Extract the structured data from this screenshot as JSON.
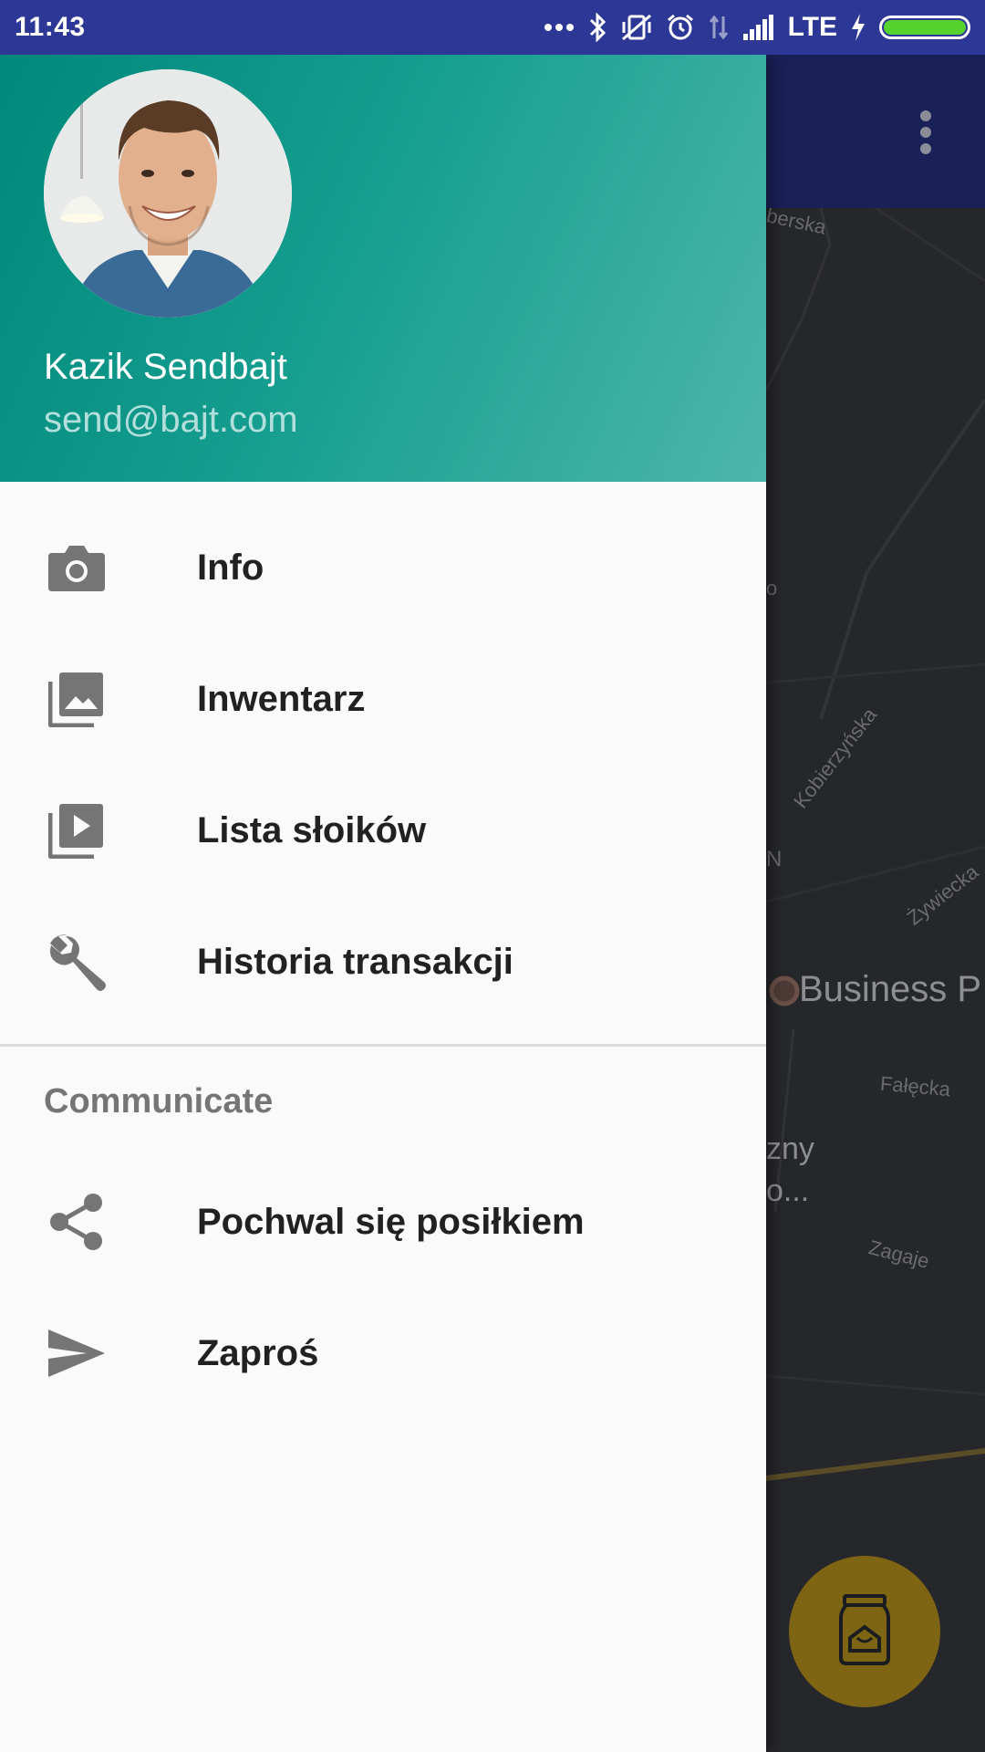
{
  "status_bar": {
    "time": "11:43",
    "network": "LTE",
    "icons": [
      "more-dots-icon",
      "bluetooth-icon",
      "vibrate-off-icon",
      "alarm-icon",
      "data-arrows-icon",
      "signal-icon",
      "charging-icon",
      "battery-icon"
    ],
    "battery_color": "#57d22e"
  },
  "drawer": {
    "header": {
      "user_name": "Kazik Sendbajt",
      "user_email": "send@bajt.com",
      "gradient": [
        "#00897b",
        "#4db6ac"
      ]
    },
    "items": [
      {
        "label": "Info",
        "icon": "camera-icon"
      },
      {
        "label": "Inwentarz",
        "icon": "photo-library-icon"
      },
      {
        "label": "Lista słoików",
        "icon": "video-library-icon"
      },
      {
        "label": "Historia transakcji",
        "icon": "wrench-icon"
      }
    ],
    "section_title": "Communicate",
    "section_items": [
      {
        "label": "Pochwal się posiłkiem",
        "icon": "share-icon"
      },
      {
        "label": "Zaproś",
        "icon": "send-icon"
      }
    ]
  },
  "background": {
    "map_labels": [
      "berska",
      "Kobierzyńska",
      "Żywiecka",
      "N",
      "Business P",
      "Fałęcka",
      "zny",
      "o...",
      "Zagaje",
      "o"
    ],
    "fab_icon": "jar-icon",
    "fab_color": "#7d6514"
  }
}
